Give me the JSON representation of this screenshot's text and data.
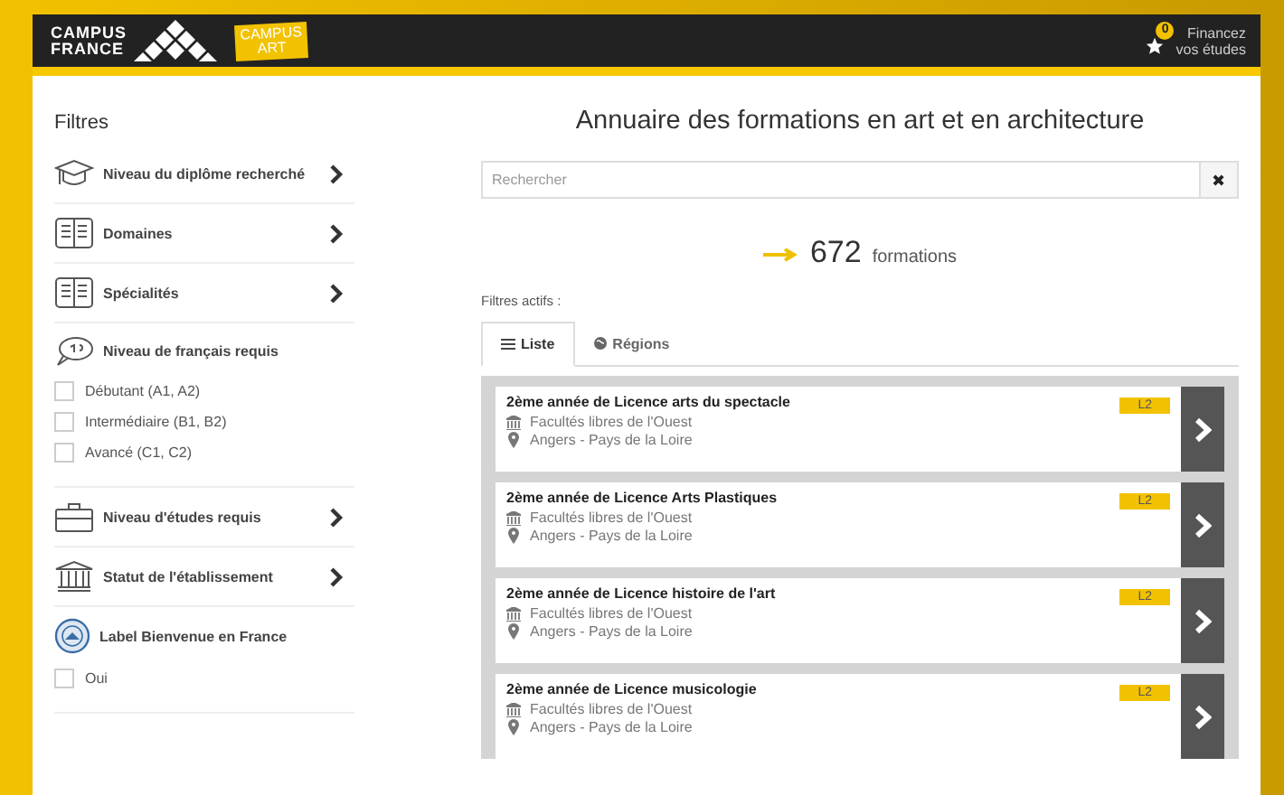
{
  "header": {
    "logo_line_1": "CAMPUS",
    "logo_line_2": "FRANCE",
    "art_tag_1": "CAMPUS",
    "art_tag_2": "ART",
    "favorites_count": "0",
    "finance_link_1": "Financez",
    "finance_link_2": "vos études"
  },
  "sidebar": {
    "title": "Filtres",
    "filters": [
      {
        "kind": "menu",
        "label": "Niveau du diplôme recherché"
      },
      {
        "kind": "menu",
        "label": "Domaines"
      },
      {
        "kind": "menu",
        "label": "Spécialités"
      },
      {
        "kind": "checks",
        "label": "Niveau de français requis",
        "options": [
          {
            "label": "Débutant (A1, A2)",
            "checked": false
          },
          {
            "label": "Intermédiaire (B1, B2)",
            "checked": false
          },
          {
            "label": "Avancé (C1, C2)",
            "checked": false
          }
        ]
      },
      {
        "kind": "menu",
        "label": "Niveau d'études requis"
      },
      {
        "kind": "menu",
        "label": "Statut de l'établissement"
      },
      {
        "kind": "checks",
        "label": "Label Bienvenue en France",
        "options": [
          {
            "label": "Oui",
            "checked": false
          }
        ]
      }
    ]
  },
  "main": {
    "title": "Annuaire des formations en art et en architecture",
    "search": {
      "placeholder": "Rechercher",
      "clear": "✖"
    },
    "count": "672",
    "count_label": "formations",
    "active_filters": "Filtres actifs :",
    "tabs": [
      {
        "label": "Liste",
        "selected": true
      },
      {
        "label": "Régions",
        "selected": false
      }
    ],
    "results": [
      {
        "title": "2ème année de Licence arts du spectacle",
        "school": "Facultés libres de l'Ouest",
        "place": "Angers - Pays de la Loire",
        "level": "L2"
      },
      {
        "title": "2ème année de Licence Arts Plastiques",
        "school": "Facultés libres de l'Ouest",
        "place": "Angers - Pays de la Loire",
        "level": "L2"
      },
      {
        "title": "2ème année de Licence histoire de l'art",
        "school": "Facultés libres de l'Ouest",
        "place": "Angers - Pays de la Loire",
        "level": "L2"
      },
      {
        "title": "2ème année de Licence musicologie",
        "school": "Facultés libres de l'Ouest",
        "place": "Angers - Pays de la Loire",
        "level": "L2"
      }
    ]
  }
}
